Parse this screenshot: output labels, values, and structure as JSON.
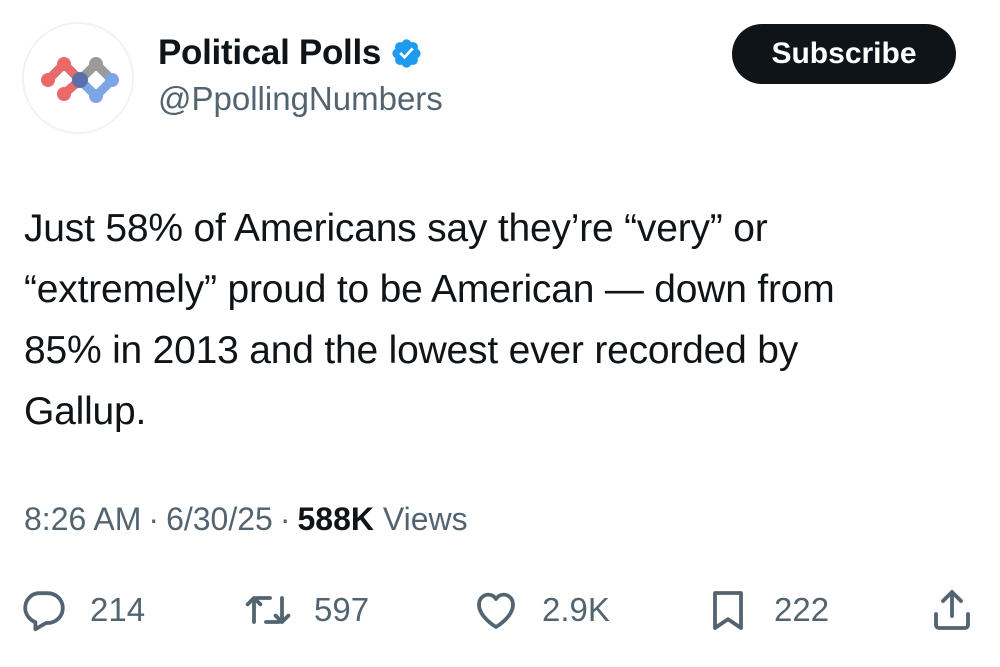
{
  "author": {
    "display_name": "Political Polls",
    "handle": "@PpollingNumbers",
    "verified": true,
    "avatar_icon": "network-logo-icon"
  },
  "subscribe_label": "Subscribe",
  "tweet": {
    "text": "Just 58% of Americans say they’re “very” or\n“extremely” proud to be American — down from\n85% in 2013 and the lowest ever recorded by\nGallup."
  },
  "meta": {
    "time": "8:26 AM",
    "separator": "·",
    "date": "6/30/25",
    "views_count": "588K",
    "views_label": "Views"
  },
  "actions": {
    "replies": "214",
    "reposts": "597",
    "likes": "2.9K",
    "bookmarks": "222"
  },
  "colors": {
    "text": "#0f1419",
    "secondary": "#536471",
    "verified_blue": "#1d9bf0",
    "button_bg": "#0f1419",
    "logo_red": "#e86a6a",
    "logo_blue": "#7aa6e6",
    "logo_gray": "#9a9a9a"
  }
}
